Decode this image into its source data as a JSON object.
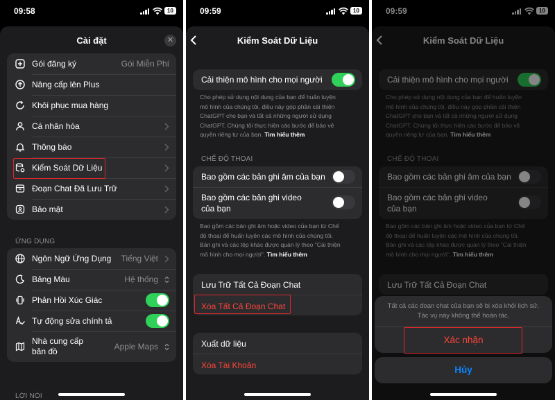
{
  "status_bar": {
    "time_1": "09:58",
    "time_2": "09:59",
    "time_3": "09:59",
    "battery": "10"
  },
  "screen1": {
    "title": "Cài đặt",
    "close_icon": "xmark-icon",
    "account_items": [
      {
        "label": "Gói đăng ký",
        "value": "Gói Miễn Phí",
        "icon": "plus-circle-icon"
      },
      {
        "label": "Nâng cấp lên Plus",
        "icon": "arrow-up-circle-icon"
      },
      {
        "label": "Khôi phục mua hàng",
        "icon": "arrow-clockwise-icon"
      },
      {
        "label": "Cá nhân hóa",
        "icon": "person-icon"
      },
      {
        "label": "Thông báo",
        "icon": "bell-icon"
      },
      {
        "label": "Kiểm Soát Dữ Liệu",
        "icon": "database-gear-icon"
      },
      {
        "label": "Đoạn Chat Đã Lưu Trữ",
        "icon": "archive-icon"
      },
      {
        "label": "Bảo mật",
        "icon": "lock-shield-icon"
      }
    ],
    "app_section_header": "ỨNG DỤNG",
    "app_language": {
      "label": "Ngôn Ngữ Ứng Dụng",
      "value": "Tiếng Việt"
    },
    "color_scheme": {
      "label": "Bảng Màu",
      "value": "Hệ thống"
    },
    "haptic": {
      "label": "Phản Hồi Xúc Giác",
      "on": true
    },
    "autocorrect": {
      "label": "Tự động sửa chính tả",
      "on": true
    },
    "map_provider": {
      "label_line1": "Nhà cung cấp",
      "label_line2": "bản đồ",
      "value": "Apple Maps"
    },
    "speech_section_header": "LỜI NÓI"
  },
  "screen2": {
    "title": "Kiểm Soát Dữ Liệu",
    "improve_model": {
      "label": "Cải thiện mô hình cho mọi người",
      "on": true
    },
    "improve_desc": [
      "Cho phép sử dụng nội dung của bạn để huấn luyện",
      "mô hình của chúng tôi, điều này góp phần cải thiện",
      "ChatGPT cho bạn và tất cả những người sử dụng",
      "ChatGPT. Chúng tôi thực hiện các bước để bảo vệ",
      "quyền riêng tư của bạn."
    ],
    "learn_more": "Tìm hiểu thêm",
    "voice_section_header": "CHẾ ĐỘ THOẠI",
    "include_audio": {
      "label": "Bao gồm các bản ghi âm của bạn",
      "on": false
    },
    "include_video": {
      "label_line1": "Bao gồm các bản ghi video",
      "label_line2": "của bạn",
      "on": false
    },
    "voice_desc": [
      "Bao gồm các bản ghi âm hoặc video của bạn từ Chế",
      "độ thoại để huấn luyện các mô hình của chúng tôi.",
      "Bản ghi và các tệp khác được quản lý theo \"Cải thiện",
      "mô hình cho mọi người\"."
    ],
    "archive_all": "Lưu Trữ Tất Cả Đoạn Chat",
    "delete_all": "Xóa Tất Cả Đoạn Chat",
    "export_data": "Xuất dữ liệu",
    "delete_account": "Xóa Tài Khoản"
  },
  "screen3": {
    "alert_line1": "Tất cả các đoạn chat của bạn sẽ bị xóa khỏi lịch sử.",
    "alert_line2": "Tác vụ này không thể hoàn tác.",
    "confirm": "Xác nhận",
    "cancel": "Hủy"
  },
  "colors": {
    "background": "#000000",
    "sheet": "#1c1c1e",
    "group": "#2c2c2e",
    "toggle_on": "#30d158",
    "destructive": "#ff453a",
    "link_blue": "#0a84ff",
    "annotation_red": "#e0262c"
  }
}
